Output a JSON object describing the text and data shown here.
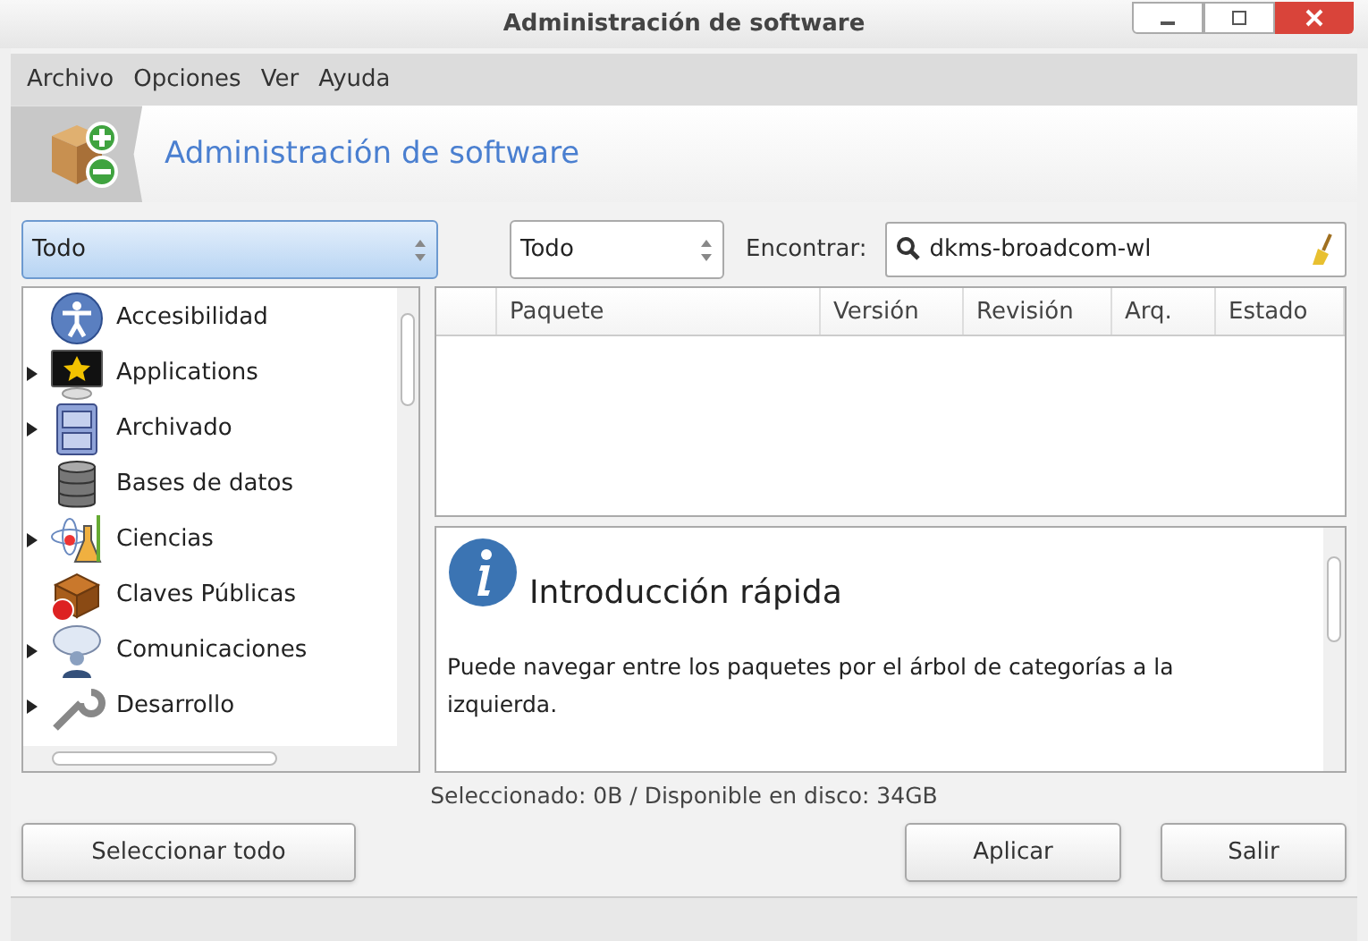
{
  "window": {
    "title": "Administración de software"
  },
  "menu": [
    "Archivo",
    "Opciones",
    "Ver",
    "Ayuda"
  ],
  "header": {
    "title": "Administración de software"
  },
  "filters": {
    "category": "Todo",
    "status": "Todo",
    "search_label": "Encontrar:",
    "search_value": "dkms-broadcom-wl"
  },
  "categories": [
    {
      "label": "Accesibilidad",
      "expandable": false
    },
    {
      "label": "Applications",
      "expandable": true
    },
    {
      "label": "Archivado",
      "expandable": true
    },
    {
      "label": "Bases de datos",
      "expandable": false
    },
    {
      "label": "Ciencias",
      "expandable": true
    },
    {
      "label": "Claves Públicas",
      "expandable": false
    },
    {
      "label": "Comunicaciones",
      "expandable": true
    },
    {
      "label": "Desarrollo",
      "expandable": true
    }
  ],
  "table": {
    "columns": [
      "Paquete",
      "Versión",
      "Revisión",
      "Arq.",
      "Estado"
    ]
  },
  "info": {
    "title": "Introducción rápida",
    "text": "Puede navegar entre los paquetes por el árbol de categorías a la izquierda."
  },
  "status": "Seleccionado: 0B / Disponible en disco: 34GB",
  "buttons": {
    "left": "Seleccionar todo",
    "apply": "Aplicar",
    "quit": "Salir"
  }
}
